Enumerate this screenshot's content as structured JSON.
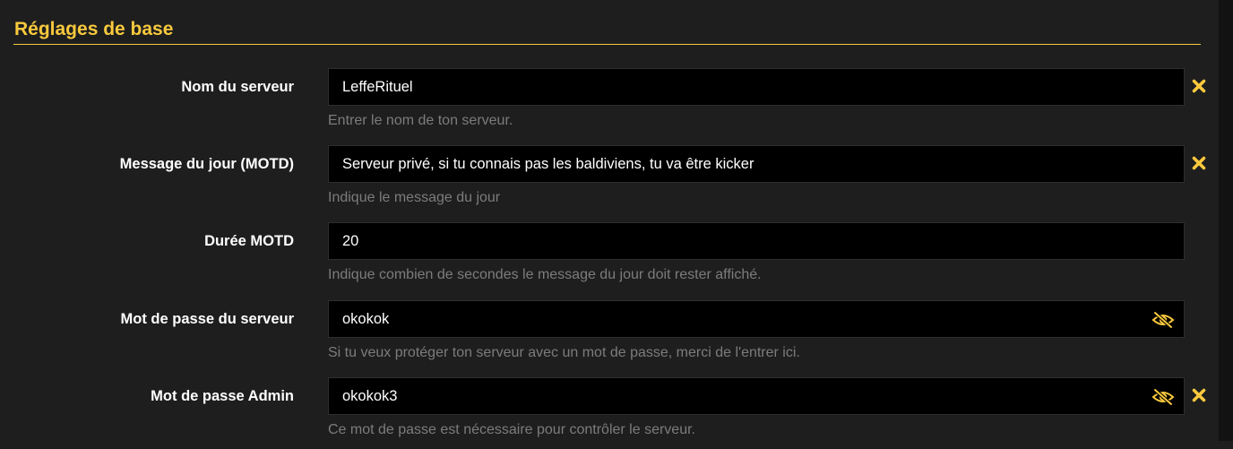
{
  "section": {
    "title": "Réglages de base"
  },
  "colors": {
    "accent": "#f9c93d",
    "background": "#1e1e1e",
    "field_background": "#000000",
    "help_text": "#7c7c7c"
  },
  "fields": [
    {
      "label": "Nom du serveur",
      "value": "LeffeRituel",
      "help": "Entrer le nom de ton serveur.",
      "icons": [
        "clear-icon"
      ]
    },
    {
      "label": "Message du jour (MOTD)",
      "value": "Serveur privé, si tu connais pas les baldiviens, tu va être kicker",
      "help": "Indique le message du jour",
      "icons": [
        "clear-icon"
      ]
    },
    {
      "label": "Durée MOTD",
      "value": "20",
      "help": "Indique combien de secondes le message du jour doit rester affiché.",
      "icons": []
    },
    {
      "label": "Mot de passe du serveur",
      "value": "okokok",
      "help": "Si tu veux protéger ton serveur avec un mot de passe, merci de l'entrer ici.",
      "icons": [
        "eye-slash-icon"
      ]
    },
    {
      "label": "Mot de passe Admin",
      "value": "okokok3",
      "help": "Ce mot de passe est nécessaire pour contrôler le serveur.",
      "icons": [
        "eye-slash-icon",
        "clear-icon"
      ]
    }
  ]
}
